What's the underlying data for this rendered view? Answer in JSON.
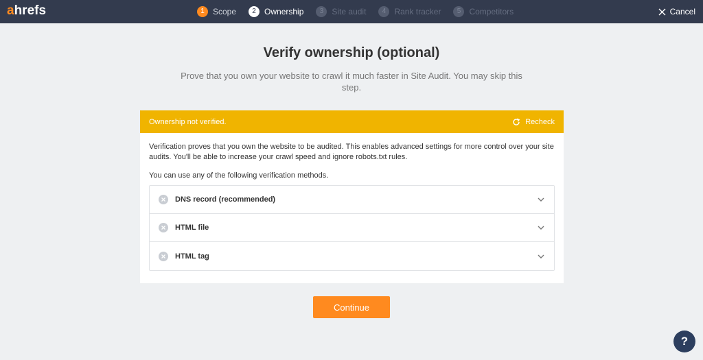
{
  "brand": {
    "logo_accent": "a",
    "logo_rest": "hrefs"
  },
  "steps": [
    {
      "num": "1",
      "label": "Scope",
      "state": "done"
    },
    {
      "num": "2",
      "label": "Ownership",
      "state": "active"
    },
    {
      "num": "3",
      "label": "Site audit",
      "state": "todo"
    },
    {
      "num": "4",
      "label": "Rank tracker",
      "state": "todo"
    },
    {
      "num": "5",
      "label": "Competitors",
      "state": "todo"
    }
  ],
  "cancel": {
    "label": "Cancel",
    "icon": "close-icon"
  },
  "page": {
    "title": "Verify ownership (optional)",
    "subtitle": "Prove that you own your website to crawl it much faster in Site Audit. You may skip this step."
  },
  "banner": {
    "status": "Ownership not verified.",
    "recheck_label": "Recheck",
    "color": "#f0b400"
  },
  "card": {
    "description": "Verification proves that you own the website to be audited. This enables advanced settings for more control over your site audits. You'll be able to increase your crawl speed and ignore robots.txt rules.",
    "methods_intro": "You can use any of the following verification methods.",
    "methods": [
      {
        "label": "DNS record (recommended)"
      },
      {
        "label": "HTML file"
      },
      {
        "label": "HTML tag"
      }
    ]
  },
  "continue_label": "Continue",
  "help_label": "?",
  "colors": {
    "accent": "#ff8a1f",
    "topbar": "#333b4e",
    "help": "#2c3e5e"
  }
}
